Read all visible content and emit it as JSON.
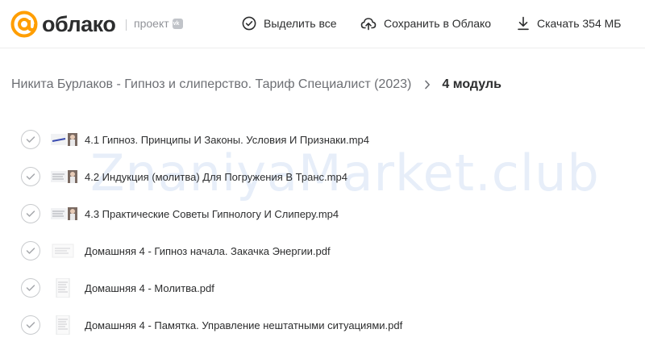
{
  "header": {
    "logo_text": "облако",
    "project_label": "проект",
    "vk_label": "vk",
    "select_all": "Выделить все",
    "save_to_cloud": "Сохранить в Облако",
    "download": "Скачать 354 МБ"
  },
  "breadcrumb": {
    "parent": "Никита Бурлаков - Гипноз и слиперство. Тариф Специалист (2023)",
    "current": "4 модуль"
  },
  "files": [
    {
      "name": "4.1 Гипноз. Принципы И Законы. Условия И Признаки.mp4",
      "type": "video"
    },
    {
      "name": "4.2 Индукция (молитва) Для Погружения В Транс.mp4",
      "type": "video"
    },
    {
      "name": "4.3 Практические Советы Гипнологу И Слиперу.mp4",
      "type": "video"
    },
    {
      "name": "Домашняя 4 - Гипноз начала. Закачка Энергии.pdf",
      "type": "pdf"
    },
    {
      "name": "Домашняя 4 - Молитва.pdf",
      "type": "pdf"
    },
    {
      "name": "Домашняя 4 - Памятка. Управление нештатными ситуациями.pdf",
      "type": "pdf"
    }
  ],
  "watermark": "ZnaniyaMarket.club",
  "colors": {
    "brand_orange": "#ff9e00",
    "text": "#2c2d2e",
    "muted": "#919399"
  }
}
